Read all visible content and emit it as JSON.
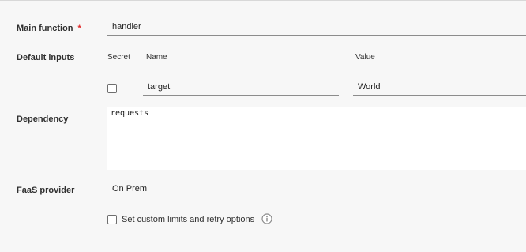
{
  "main_function": {
    "label": "Main function",
    "required_marker": "*",
    "value": "handler"
  },
  "default_inputs": {
    "label": "Default inputs",
    "columns": {
      "secret": "Secret",
      "name": "Name",
      "value": "Value"
    },
    "rows": [
      {
        "secret": false,
        "name": "target",
        "value": "World"
      }
    ]
  },
  "dependency": {
    "label": "Dependency",
    "value": "requests"
  },
  "faas_provider": {
    "label": "FaaS provider",
    "value": "On Prem"
  },
  "custom_limits": {
    "checked": false,
    "label": "Set custom limits and retry options",
    "icon": "info-circle-icon"
  }
}
